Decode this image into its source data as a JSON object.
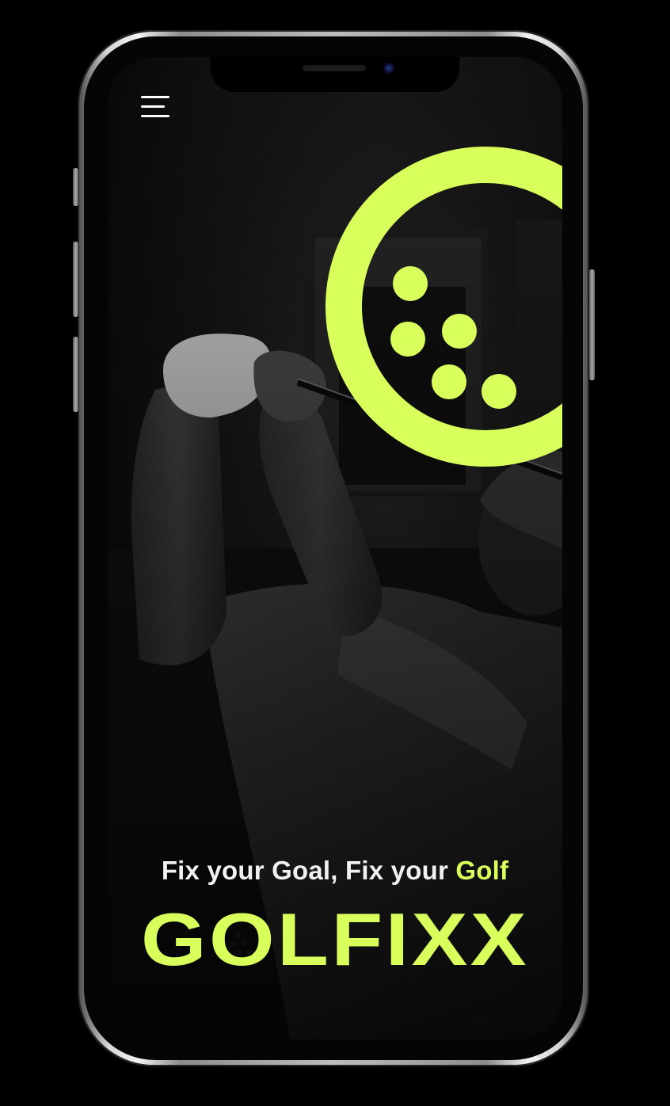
{
  "app": {
    "tagline_prefix": "Fix your Goal, Fix your ",
    "tagline_accent": "Golf",
    "brand_name": "GOLFIXX"
  },
  "icons": {
    "menu": "hamburger-menu-icon",
    "logo": "golf-ball-logo-icon"
  },
  "colors": {
    "accent": "#d9ff5c",
    "background": "#000000",
    "text": "#f1f1f1"
  }
}
